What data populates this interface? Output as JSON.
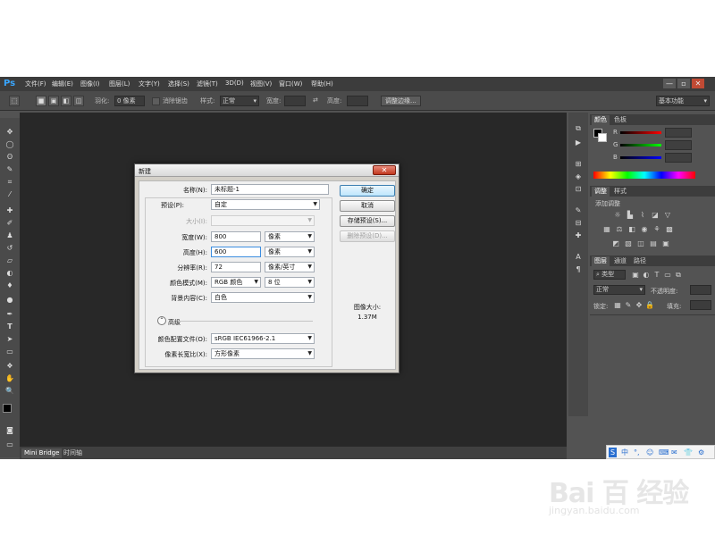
{
  "app": {
    "logo": "Ps",
    "menu": [
      "文件(F)",
      "编辑(E)",
      "图像(I)",
      "图层(L)",
      "文字(Y)",
      "选择(S)",
      "滤镜(T)",
      "3D(D)",
      "视图(V)",
      "窗口(W)",
      "帮助(H)"
    ],
    "window_buttons": [
      "—",
      "▫",
      "✕"
    ]
  },
  "options_bar": {
    "feather_label": "羽化:",
    "feather_value": "0 像素",
    "antialias_label": "消除锯齿",
    "style_label": "样式:",
    "style_value": "正常",
    "width_label": "宽度:",
    "height_label": "高度:",
    "refine_button": "调整边缘...",
    "workspace": "基本功能"
  },
  "bottom_tabs": [
    "Mini Bridge",
    "时间轴"
  ],
  "panels": {
    "color_tabs": [
      "颜色",
      "色板"
    ],
    "color_channels": [
      "R",
      "G",
      "B"
    ],
    "adjust_tabs": [
      "调整",
      "样式"
    ],
    "adjust_title": "添加调整",
    "layers_tabs": [
      "图层",
      "通道",
      "路径"
    ],
    "layers_filter": "类型",
    "blend_mode": "正常",
    "opacity_label": "不透明度:",
    "lock_label": "锁定:",
    "fill_label": "填充:"
  },
  "dialog": {
    "title": "新建",
    "close": "✕",
    "name_label": "名称(N):",
    "name_value": "未标题-1",
    "preset_label": "预设(P):",
    "preset_value": "自定",
    "size_label": "大小(I):",
    "width_label": "宽度(W):",
    "width_value": "800",
    "width_unit": "像素",
    "height_label": "高度(H):",
    "height_value": "600",
    "height_unit": "像素",
    "resolution_label": "分辨率(R):",
    "resolution_value": "72",
    "resolution_unit": "像素/英寸",
    "mode_label": "颜色模式(M):",
    "mode_value": "RGB 颜色",
    "mode_bits": "8 位",
    "bg_label": "背景内容(C):",
    "bg_value": "白色",
    "advanced_label": "高级",
    "profile_label": "颜色配置文件(O):",
    "profile_value": "sRGB IEC61966-2.1",
    "pixel_ratio_label": "像素长宽比(X):",
    "pixel_ratio_value": "方形像素",
    "ok_button": "确定",
    "cancel_button": "取消",
    "save_preset_button": "存储预设(S)...",
    "delete_preset_button": "删除预设(D)...",
    "image_size_label": "图像大小:",
    "image_size_value": "1.37M"
  },
  "watermark": {
    "logo": "Bai 百 经验",
    "url": "jingyan.baidu.com"
  },
  "ime": [
    "中",
    "°,",
    "☺",
    "⌨",
    "✉",
    "👕",
    "⚙"
  ],
  "colors": {
    "accent": "#39a6ff",
    "canvas": "#282828",
    "panel": "#535353"
  }
}
